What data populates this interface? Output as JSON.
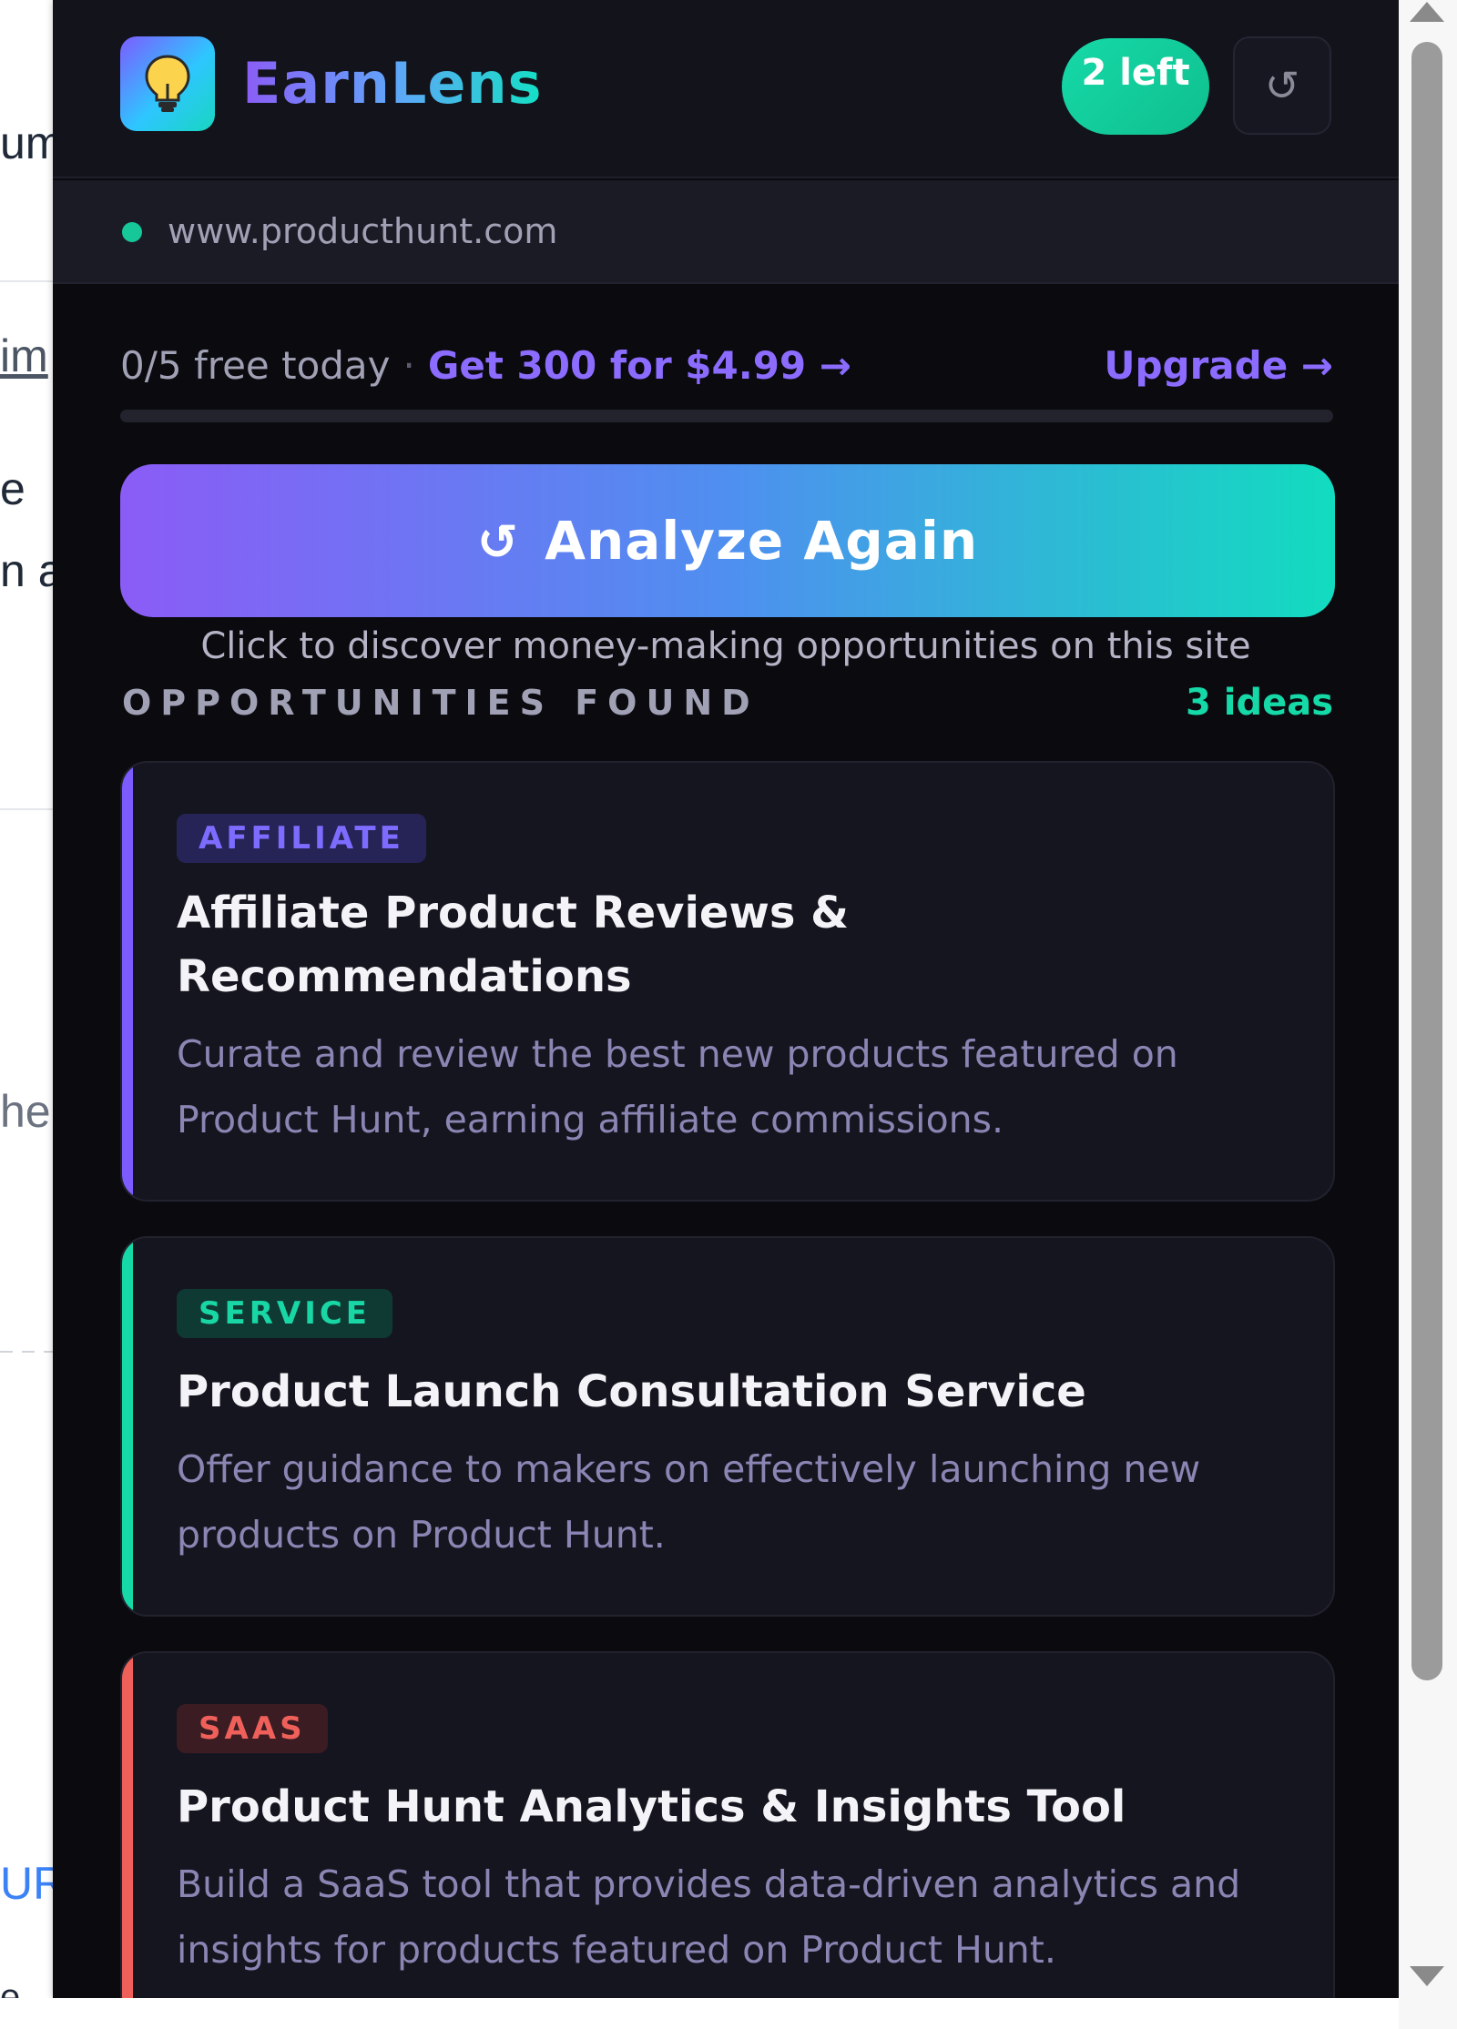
{
  "background_page": {
    "fragments": [
      "um",
      "im",
      "e",
      "n a",
      "her",
      "UR",
      "e"
    ]
  },
  "header": {
    "brand": "EarnLens",
    "credits_badge": "2 left",
    "refresh_icon": "refresh-icon",
    "logo_icon": "lightbulb-icon"
  },
  "site": {
    "url": "www.producthunt.com"
  },
  "quota": {
    "usage": "0/5 free today",
    "separator": "·",
    "offer": "Get 300 for $4.99 →",
    "upgrade": "Upgrade →",
    "used_fraction": 0
  },
  "analyze": {
    "icon": "↺",
    "label": "Analyze Again",
    "hint": "Click to discover money-making opportunities on this site"
  },
  "opportunities": {
    "title": "OPPORTUNITIES FOUND",
    "count": "3 ideas",
    "items": [
      {
        "tag": "AFFILIATE",
        "title": "Affiliate Product Reviews & Recommendations",
        "description": "Curate and review the best new products featured on Product Hunt, earning affiliate commissions.",
        "accent_color": "#7c5cff",
        "tag_bg": "#262456",
        "tag_color": "#7c6cff"
      },
      {
        "tag": "SERVICE",
        "title": "Product Launch Consultation Service",
        "description": "Offer guidance to makers on effectively launching new products on Product Hunt.",
        "accent_color": "#16d9a8",
        "tag_bg": "#0f3a33",
        "tag_color": "#19d6a5"
      },
      {
        "tag": "SAAS",
        "title": "Product Hunt Analytics & Insights Tool",
        "description": "Build a SaaS tool that provides data-driven analytics and insights for products featured on Product Hunt.",
        "accent_color": "#f0605a",
        "tag_bg": "#3a1c22",
        "tag_color": "#f0605a"
      }
    ]
  }
}
